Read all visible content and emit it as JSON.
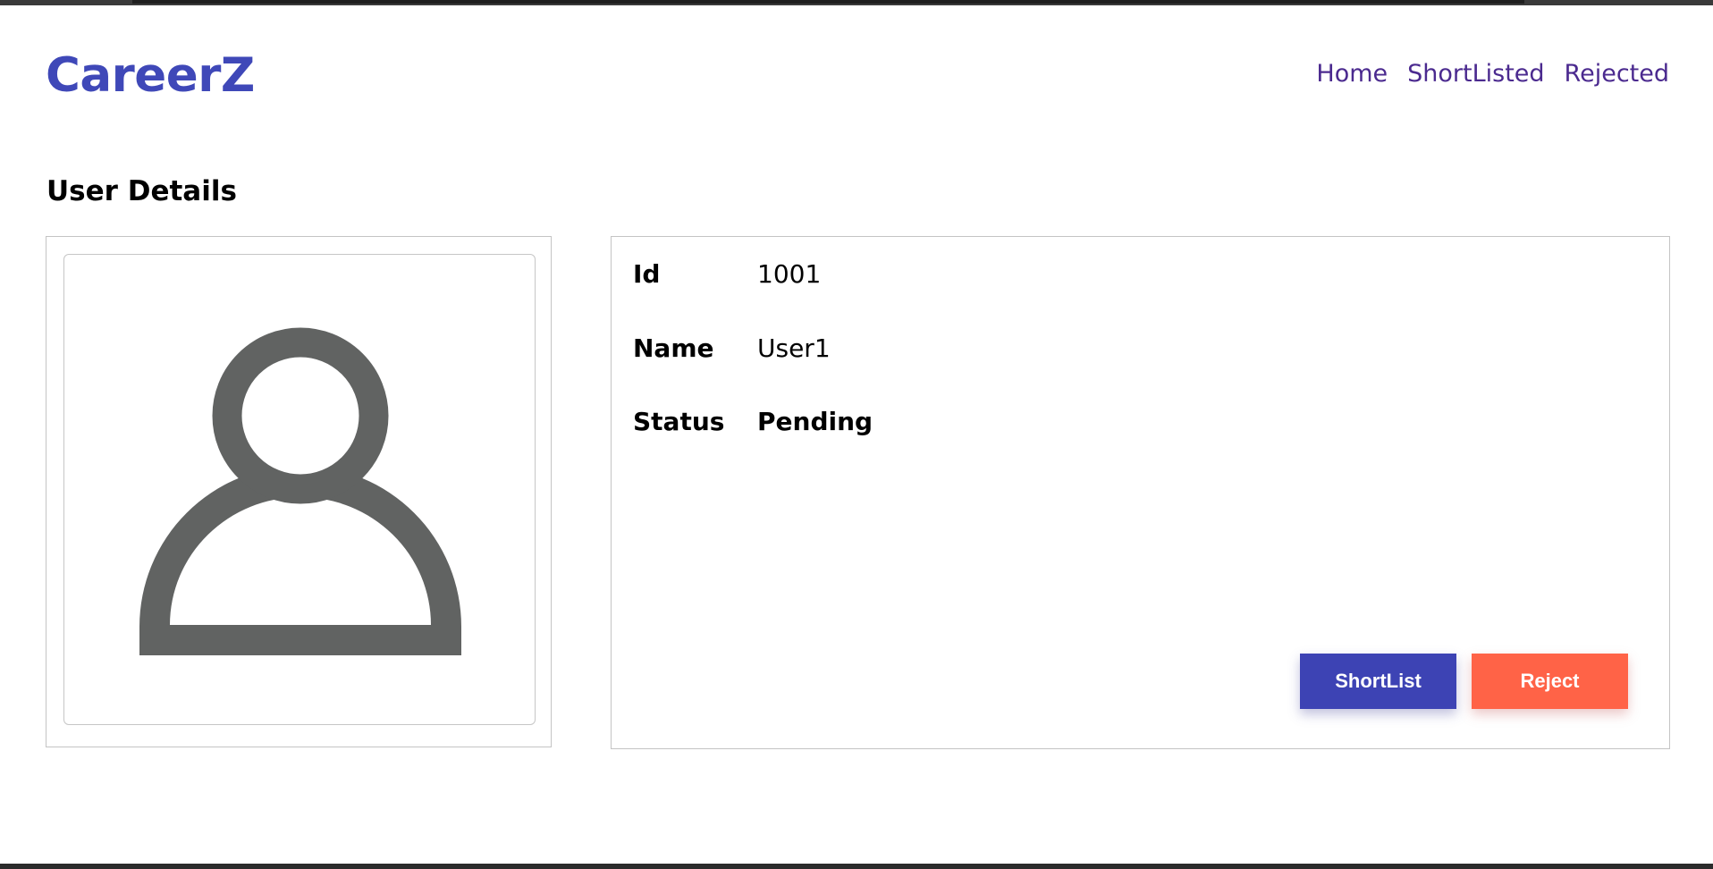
{
  "app": {
    "logo": "CareerZ"
  },
  "nav": {
    "items": [
      "Home",
      "ShortListed",
      "Rejected"
    ]
  },
  "page": {
    "title": "User Details"
  },
  "user": {
    "avatar_icon": "user-avatar-icon",
    "fields": [
      {
        "label": "Id",
        "value": "1001"
      },
      {
        "label": "Name",
        "value": "User1"
      },
      {
        "label": "Status",
        "value": "Pending"
      }
    ]
  },
  "actions": {
    "shortlist_label": "ShortList",
    "reject_label": "Reject"
  },
  "colors": {
    "brand": "#3f48b8",
    "nav_link": "#4b2a8f",
    "shortlist_button": "#3d43b4",
    "reject_button": "#ff6347",
    "avatar_gray": "#616362"
  }
}
